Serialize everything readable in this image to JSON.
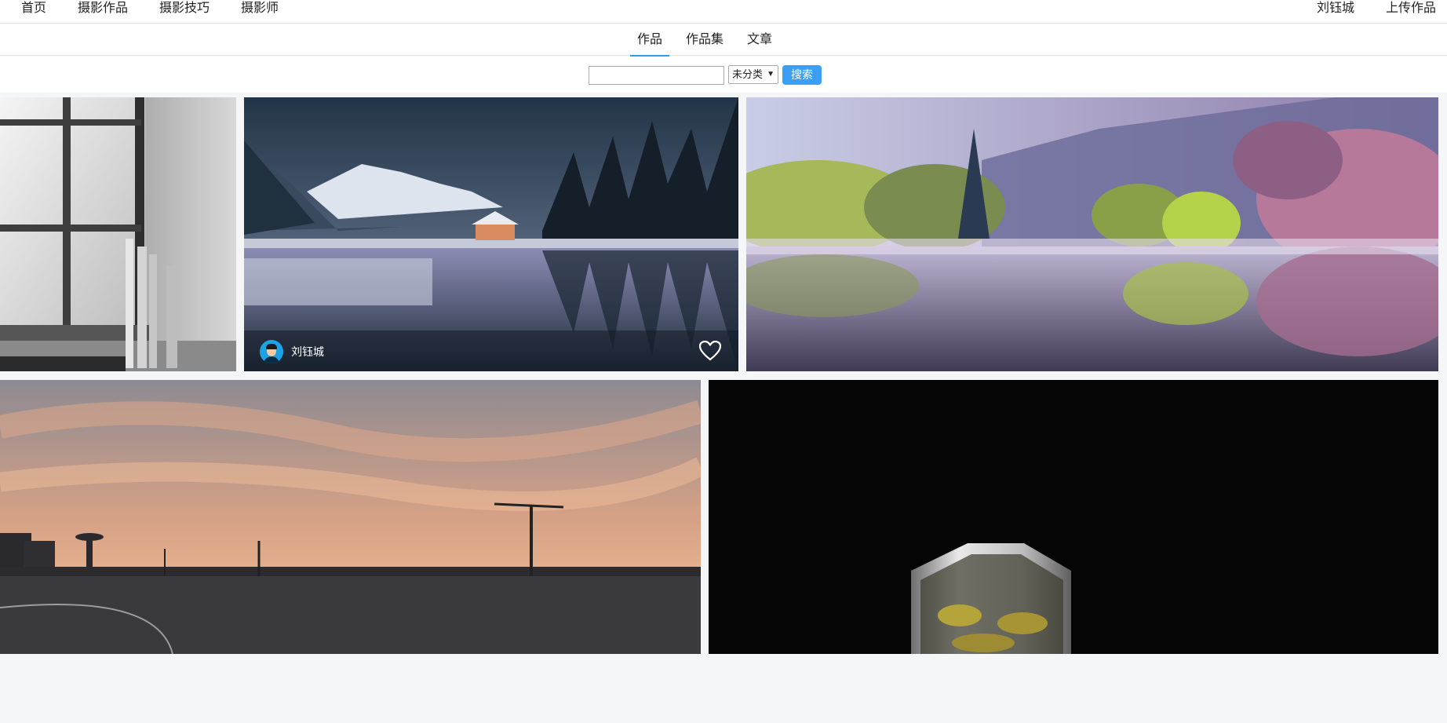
{
  "topnav": {
    "home": "首页",
    "works": "摄影作品",
    "tips": "摄影技巧",
    "photographers": "摄影师",
    "user": "刘钰城",
    "upload": "上传作品"
  },
  "tabs": [
    {
      "label": "作品",
      "active": true
    },
    {
      "label": "作品集",
      "active": false
    },
    {
      "label": "文章",
      "active": false
    }
  ],
  "search": {
    "value": "",
    "placeholder": "",
    "category_selected": "未分类",
    "button_label": "搜索"
  },
  "gallery": [
    {
      "subject": "frosted window with thermometers, black and white"
    },
    {
      "subject": "snowy lake cabin at dusk with mountains and pines",
      "author": "刘钰城",
      "icons": [
        "avatar",
        "heart-icon"
      ]
    },
    {
      "subject": "misty lake with purple and green trees reflection"
    },
    {
      "subject": "sunset sky over road with street lamps"
    },
    {
      "subject": "glass cup with leaves on black background"
    }
  ],
  "colors": {
    "accent": "#2a9ff5",
    "button": "#3a9ff5",
    "background": "#f5f6f8"
  }
}
